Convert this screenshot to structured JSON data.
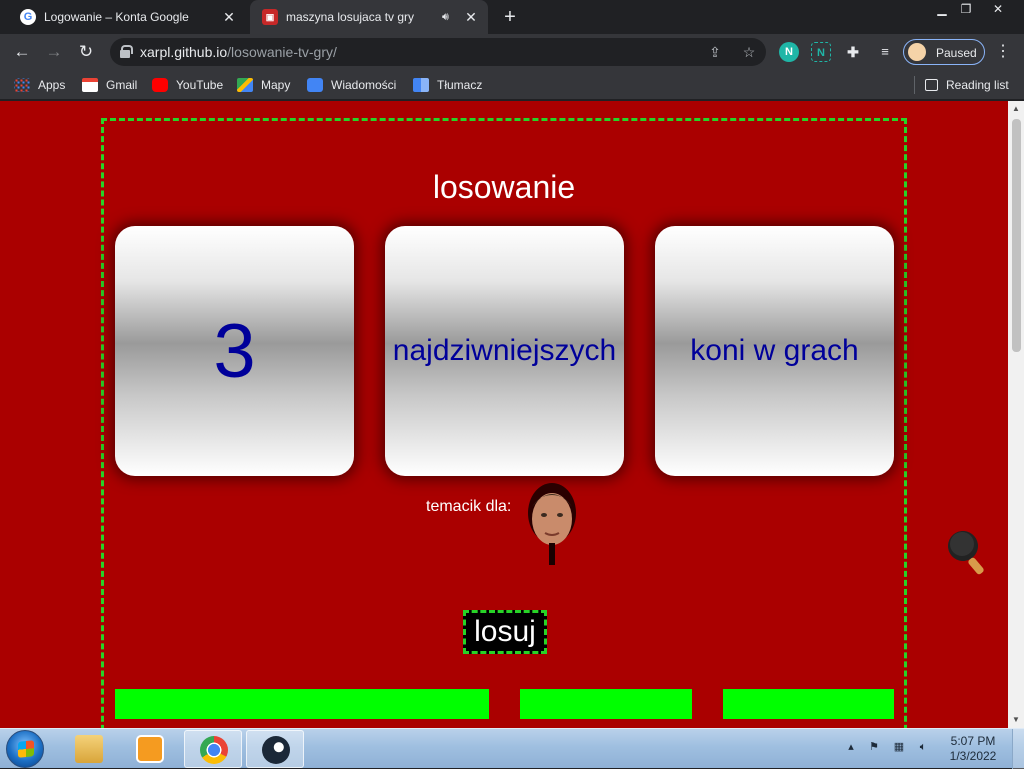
{
  "browser": {
    "tabs": [
      {
        "title": "Logowanie – Konta Google",
        "favicon": "google-icon",
        "active": false
      },
      {
        "title": "maszyna losujaca tv gry",
        "favicon": "site-icon",
        "active": true,
        "audio": true
      }
    ],
    "url_domain": "xarpl.github.io",
    "url_path": "/losowanie-tv-gry/",
    "profile_label": "Paused",
    "bookmarks": [
      "Apps",
      "Gmail",
      "YouTube",
      "Mapy",
      "Wiadomości",
      "Tłumacz"
    ],
    "reading_list": "Reading list"
  },
  "page": {
    "heading": "losowanie",
    "slots": [
      "3",
      "najdziwniejszych",
      "koni w grach"
    ],
    "topic_label": "temacik dla:",
    "draw_button": "losuj",
    "colors": {
      "background": "#aa0000",
      "accent": "#27d427",
      "bar": "#00ff00",
      "slot_text": "#00009a"
    }
  },
  "taskbar": {
    "time": "5:07 PM",
    "date": "1/3/2022"
  }
}
